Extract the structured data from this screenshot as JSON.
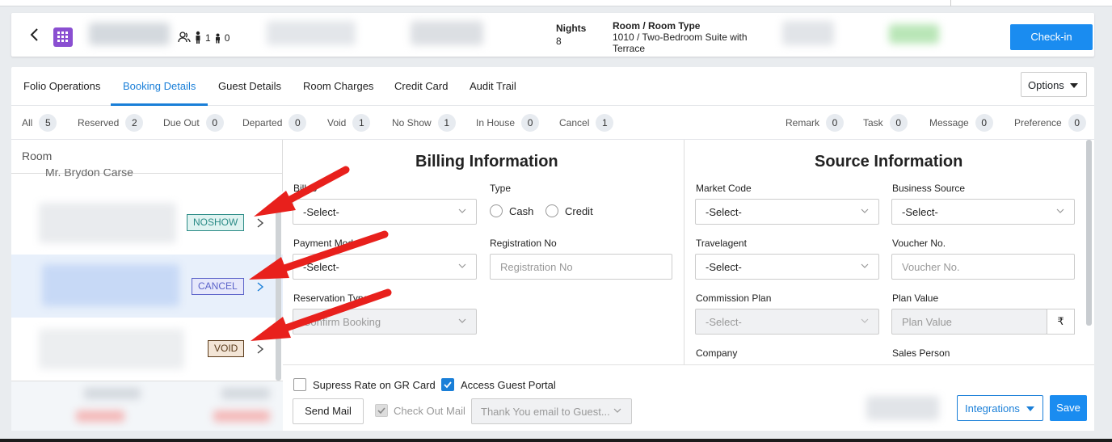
{
  "header": {
    "nights_label": "Nights",
    "nights_value": "8",
    "room_label": "Room / Room Type",
    "room_value": "1010 / Two-Bedroom Suite with Terrace",
    "adults": "1",
    "children": "0",
    "checkin_label": "Check-in"
  },
  "tabs": [
    {
      "label": "Folio Operations"
    },
    {
      "label": "Booking Details"
    },
    {
      "label": "Guest Details"
    },
    {
      "label": "Room Charges"
    },
    {
      "label": "Credit Card"
    },
    {
      "label": "Audit Trail"
    }
  ],
  "active_tab": "Booking Details",
  "options_label": "Options",
  "status_counts": [
    {
      "label": "All",
      "count": "5"
    },
    {
      "label": "Reserved",
      "count": "2"
    },
    {
      "label": "Due Out",
      "count": "0"
    },
    {
      "label": "Departed",
      "count": "0"
    },
    {
      "label": "Void",
      "count": "1"
    },
    {
      "label": "No Show",
      "count": "1"
    },
    {
      "label": "In House",
      "count": "0"
    },
    {
      "label": "Cancel",
      "count": "1"
    }
  ],
  "note_counts": [
    {
      "label": "Remark",
      "count": "0"
    },
    {
      "label": "Task",
      "count": "0"
    },
    {
      "label": "Message",
      "count": "0"
    },
    {
      "label": "Preference",
      "count": "0"
    }
  ],
  "room_panel": {
    "header": "Room",
    "partial_guest": "Mr. Brydon Carse",
    "items": [
      {
        "status": "NOSHOW"
      },
      {
        "status": "CANCEL"
      },
      {
        "status": "VOID"
      }
    ]
  },
  "billing": {
    "title": "Billing Information",
    "bill_to_label": "Bill to",
    "bill_to_value": "-Select-",
    "type_label": "Type",
    "type_cash": "Cash",
    "type_credit": "Credit",
    "payment_mode_label": "Payment Mode",
    "payment_mode_value": "-Select-",
    "registration_label": "Registration No",
    "registration_placeholder": "Registration No",
    "reservation_type_label": "Reservation Type",
    "reservation_type_value": "Confirm Booking"
  },
  "source": {
    "title": "Source Information",
    "market_code_label": "Market Code",
    "market_code_value": "-Select-",
    "business_source_label": "Business Source",
    "business_source_value": "-Select-",
    "travelagent_label": "Travelagent",
    "travelagent_value": "-Select-",
    "voucher_label": "Voucher No.",
    "voucher_placeholder": "Voucher No.",
    "commission_label": "Commission Plan",
    "commission_value": "-Select-",
    "plan_value_label": "Plan Value",
    "plan_value_placeholder": "Plan Value",
    "currency_symbol": "₹",
    "company_label": "Company",
    "sales_person_label": "Sales Person"
  },
  "footer": {
    "supress_label": "Supress Rate on GR Card",
    "access_portal_label": "Access Guest Portal",
    "send_mail_label": "Send Mail",
    "checkout_mail_label": "Check Out Mail",
    "email_template_value": "Thank You email to Guest...",
    "integrations_label": "Integrations",
    "save_label": "Save"
  },
  "colors": {
    "accent": "#1a8cf0",
    "noshow_bg": "#dff3f1",
    "noshow_text": "#2a8b86",
    "cancel_bg": "#e6e8fb",
    "cancel_text": "#5b63c9",
    "void_bg": "#f3e5d6",
    "void_text": "#5a3a1a",
    "annotation_arrow": "#e8201c"
  }
}
